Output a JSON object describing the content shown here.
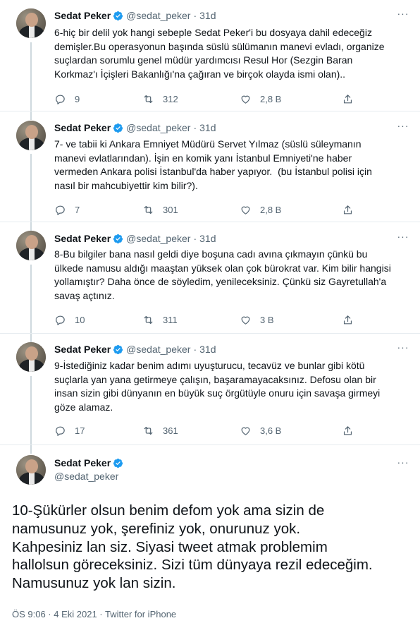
{
  "author": {
    "name": "Sedat Peker",
    "handle": "@sedat_peker"
  },
  "thread": [
    {
      "time": "31d",
      "text": "6-hiç bir delil yok hangi sebeple Sedat Peker'i bu dosyaya dahil edeceğiz\ndemişler.Bu operasyonun başında süslü sülümanın manevi evladı, organize\nsuçlardan sorumlu genel müdür yardımcısı Resul Hor (Sezgin Baran\nKorkmaz'ı İçişleri Bakanlığı'na çağıran ve birçok olayda ismi olan)..",
      "replies": "9",
      "retweets": "312",
      "likes": "2,8 B"
    },
    {
      "time": "31d",
      "text": "7- ve tabii ki Ankara Emniyet Müdürü Servet Yılmaz (süslü süleymanın\nmanevi evlatlarından). İşin en komik yanı İstanbul Emniyeti'ne haber\nvermeden Ankara polisi İstanbul'da haber yapıyor.  (bu İstanbul polisi için\nnasıl bir mahcubiyettir kim bilir?).",
      "replies": "7",
      "retweets": "301",
      "likes": "2,8 B"
    },
    {
      "time": "31d",
      "text": "8-Bu bilgiler bana nasıl geldi diye boşuna cadı avına çıkmayın çünkü bu\nülkede namusu aldığı maaştan yüksek olan çok bürokrat var. Kim bilir hangisi\nyollamıştır? Daha önce de söyledim, yenileceksiniz. Çünkü siz Gayretullah'a\nsavaş açtınız.",
      "replies": "10",
      "retweets": "311",
      "likes": "3 B"
    },
    {
      "time": "31d",
      "text": "9-İstediğiniz kadar benim adımı uyuşturucu, tecavüz ve bunlar gibi kötü\nsuçlarla yan yana getirmeye çalışın, başaramayacaksınız. Defosu olan bir\ninsan sizin gibi dünyanın en büyük suç örgütüyle onuru için savaşa girmeyi\ngöze alamaz.",
      "replies": "17",
      "retweets": "361",
      "likes": "3,6 B"
    }
  ],
  "main": {
    "text": "10-Şükürler olsun benim defom yok ama sizin de\nnamusunuz yok, şerefiniz yok, onurunuz yok.\nKahpesiniz lan siz. Siyasi tweet atmak problemim\nhallolsun göreceksiniz. Sizi tüm dünyaya rezil edeceğim.\nNamusunuz yok lan sizin.",
    "meta": "ÖS 9:06 · 4 Eki 2021 · Twitter for iPhone"
  },
  "ui": {
    "dot": "·",
    "more": "···"
  },
  "colors": {
    "verified": "#1d9bf0",
    "secondary_text": "#536471",
    "divider": "#e6ecf0"
  },
  "icons": [
    "reply-icon",
    "retweet-icon",
    "like-icon",
    "share-icon",
    "verified-icon",
    "more-icon"
  ]
}
